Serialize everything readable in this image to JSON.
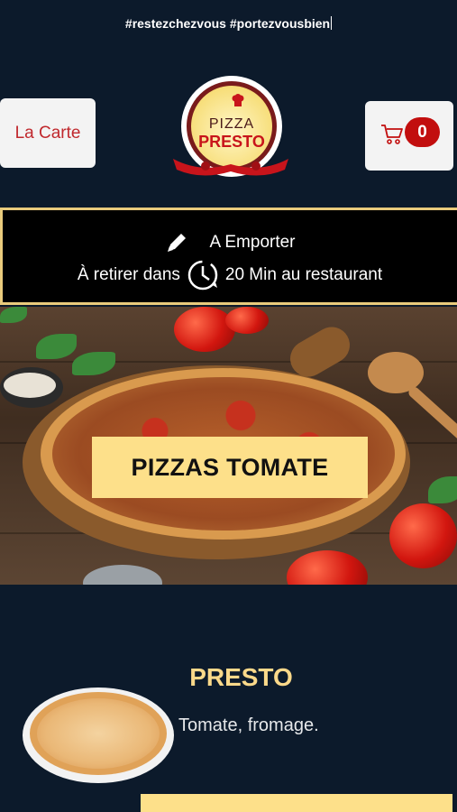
{
  "banner": {
    "hashtags": "#restezchezvous #portezvousbien"
  },
  "header": {
    "menu_button_label": "La Carte",
    "logo_line1": "PIZZA",
    "logo_line2": "PRESTO",
    "cart_count": "0"
  },
  "order_info": {
    "mode": "A Emporter",
    "pickup_prefix": "À retirer dans",
    "pickup_suffix": "20 Min au restaurant"
  },
  "category": {
    "title": "PIZZAS TOMATE"
  },
  "products": [
    {
      "name": "PRESTO",
      "description": "Tomate, fromage."
    }
  ],
  "colors": {
    "background": "#0c1a2b",
    "accent_gold": "#fde08a",
    "brand_red": "#c20e0e",
    "button_bg": "#f3f3f3"
  },
  "icons": [
    "pencil-icon",
    "clock-icon",
    "cart-icon",
    "chef-hat-icon"
  ]
}
